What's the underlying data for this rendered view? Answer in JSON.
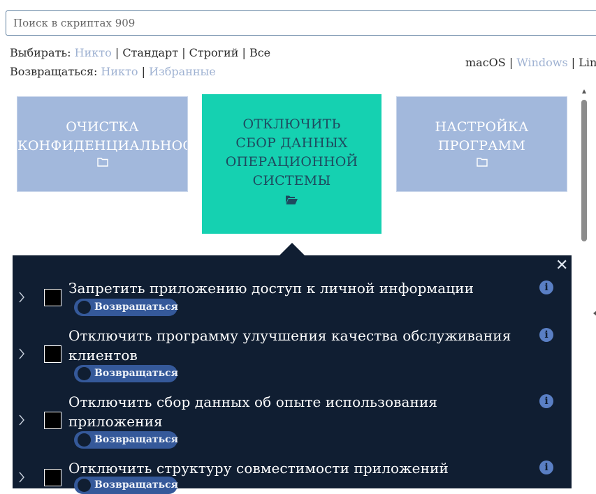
{
  "search": {
    "placeholder": "Поиск в скриптах 909"
  },
  "select": {
    "label": "Выбирать:",
    "options": [
      {
        "label": "Никто",
        "active": true
      },
      {
        "label": "Стандарт"
      },
      {
        "label": "Строгий"
      },
      {
        "label": "Все"
      }
    ]
  },
  "revert": {
    "label": "Возвращаться:",
    "options": [
      {
        "label": "Никто"
      },
      {
        "label": "Избранные"
      }
    ]
  },
  "os": [
    {
      "label": "macOS"
    },
    {
      "label": "Windows"
    },
    {
      "label": "Linux"
    }
  ],
  "separator": "|",
  "cards": [
    {
      "line1": "ОЧИСТКА",
      "line2": "КОНФИДЕНЦИАЛЬНОСТИ",
      "icon": "folder-icon"
    },
    {
      "lines": [
        "ОТКЛЮЧИТЬ",
        "СБОР ДАННЫХ",
        "ОПЕРАЦИОННОЙ",
        "СИСТЕМЫ"
      ],
      "icon": "folder-open-icon",
      "selected": true
    },
    {
      "line1": "НАСТРОЙКА",
      "line2": "ПРОГРАММ",
      "icon": "folder-icon"
    }
  ],
  "panel": {
    "close": "✕",
    "items": [
      {
        "title": "Запретить приложению доступ к личной информации",
        "toggle": "Возвращаться"
      },
      {
        "title": "Отключить программу улучшения качества обслуживания клиентов",
        "toggle": "Возвращаться"
      },
      {
        "title": "Отключить сбор данных об опыте использования приложения",
        "toggle": "Возвращаться"
      },
      {
        "title": "Отключить структуру совместимости приложений",
        "toggle": "Возвращаться"
      }
    ]
  },
  "colors": {
    "card": "#a2b8dc",
    "card_selected": "#15d1b1",
    "panel": "#101e32",
    "link": "#9fb2d2",
    "toggle": "#35599a",
    "info": "#5a7fc4"
  }
}
